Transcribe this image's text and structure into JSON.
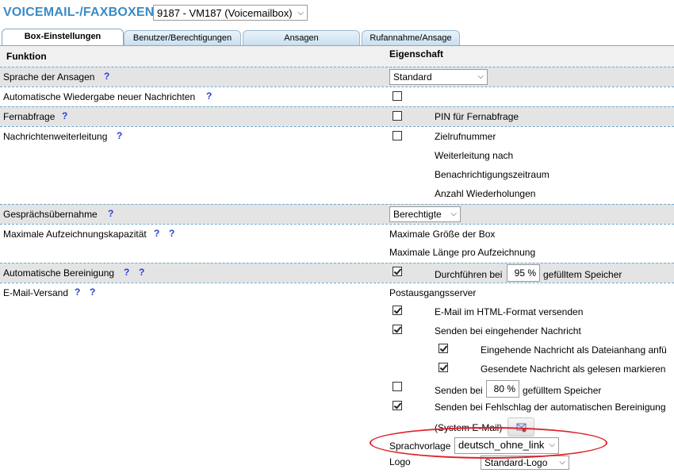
{
  "header": {
    "title": "VOICEMAIL-/FAXBOXEN",
    "box_select": "9187 - VM187 (Voicemailbox)"
  },
  "tabs": [
    {
      "label": "Box-Einstellungen",
      "active": true
    },
    {
      "label": "Benutzer/Berechtigungen",
      "active": false
    },
    {
      "label": "Ansagen",
      "active": false
    },
    {
      "label": "Rufannahme/Ansage",
      "active": false
    }
  ],
  "columns": {
    "function": "Funktion",
    "property": "Eigenschaft"
  },
  "help_glyph": "?",
  "rows": {
    "sprache": {
      "label": "Sprache der Ansagen",
      "value": "Standard"
    },
    "wiedergabe": {
      "label": "Automatische Wiedergabe neuer Nachrichten",
      "checked": false
    },
    "fernabfrage": {
      "label": "Fernabfrage",
      "checked": false,
      "pin_label": "PIN für Fernabfrage"
    },
    "weiterleitung": {
      "label": "Nachrichtenweiterleitung",
      "checked": false,
      "items": [
        "Zielrufnummer",
        "Weiterleitung nach",
        "Benachrichtigungszeitraum",
        "Anzahl Wiederholungen"
      ]
    },
    "uebernahme": {
      "label": "Gesprächsübernahme",
      "value": "Berechtigte"
    },
    "kapazitaet": {
      "label": "Maximale Aufzeichnungskapazität",
      "max_box": "Maximale Größe der Box",
      "max_recording": "Maximale Länge pro Aufzeichnung"
    },
    "bereinigung": {
      "label": "Automatische Bereinigung",
      "checked": true,
      "pre": "Durchführen bei",
      "value": "95 %",
      "post": "gefülltem Speicher"
    },
    "email": {
      "label": "E-Mail-Versand",
      "server": "Postausgangsserver",
      "html_format": {
        "label": "E-Mail im HTML-Format versenden",
        "checked": true
      },
      "incoming": {
        "label": "Senden bei eingehender Nachricht",
        "checked": true
      },
      "attachment": {
        "label": "Eingehende Nachricht als Dateianhang anfü",
        "checked": true
      },
      "mark_read": {
        "label": "Gesendete Nachricht als gelesen markieren",
        "checked": true
      },
      "storage": {
        "pre": "Senden bei",
        "value": "80 %",
        "post": "gefülltem Speicher",
        "checked": false
      },
      "cleanup_fail": {
        "label": "Senden bei Fehlschlag der automatischen Bereinigung",
        "checked": true
      },
      "system_email": "(System E-Mail)",
      "template": {
        "label": "Sprachvorlage",
        "value": "deutsch_ohne_link"
      },
      "logo": {
        "label": "Logo",
        "value": "Standard-Logo"
      }
    }
  },
  "colors": {
    "title": "#3a8bc4",
    "help": "#2a3fd0",
    "highlight": "#e0202a",
    "row_alt": "#e4e4e4"
  }
}
